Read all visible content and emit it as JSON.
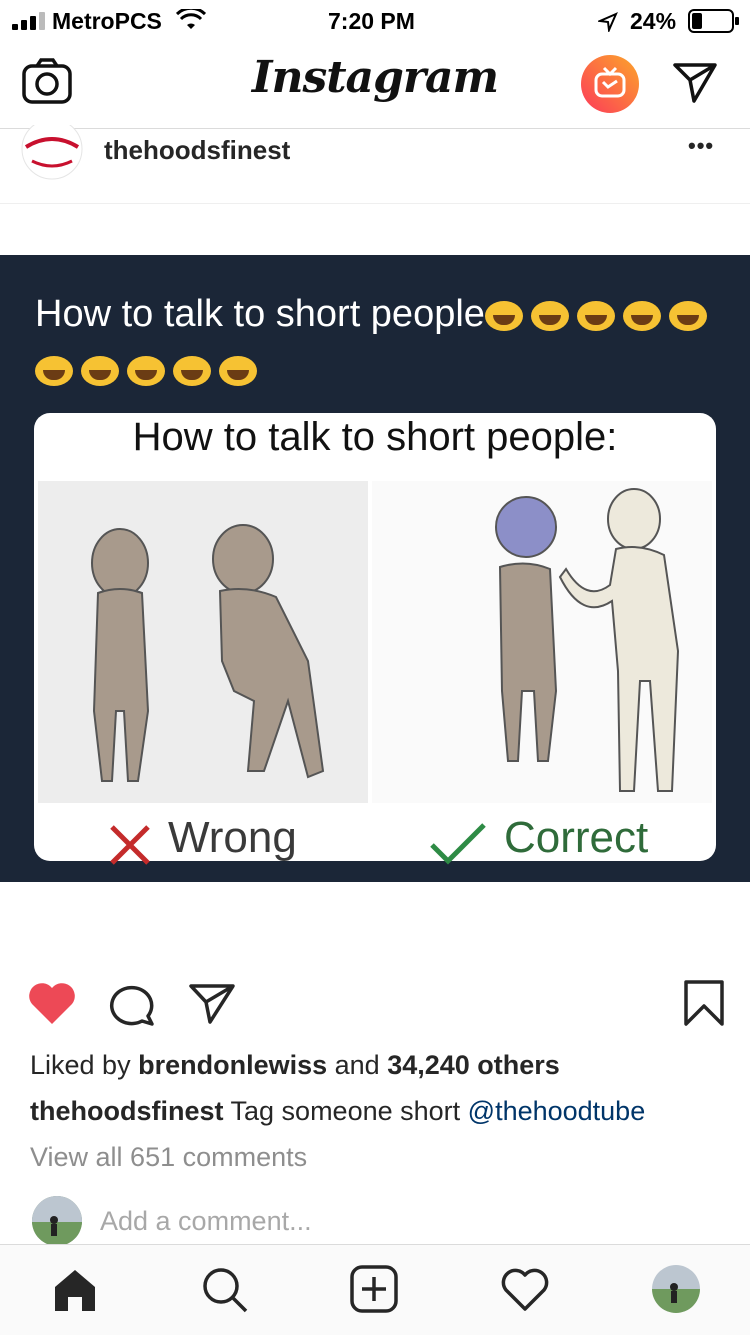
{
  "status": {
    "carrier": "MetroPCS",
    "time": "7:20 PM",
    "battery": "24%"
  },
  "header": {
    "title": "Instagram"
  },
  "post": {
    "username": "thehoodsfinest",
    "more": "•••",
    "image": {
      "caption_top": "How to talk to short people",
      "card_title": "How to talk to short people:",
      "wrong_label": "Wrong",
      "correct_label": "Correct"
    },
    "likes": {
      "prefix": "Liked by ",
      "user": "brendonlewiss",
      "mid": " and ",
      "count": "34,240 others"
    },
    "caption": {
      "user": "thehoodsfinest",
      "text": " Tag someone short ",
      "mention": "@thehoodtube"
    },
    "view_comments": "View all 651 comments",
    "comment_placeholder": "Add a comment..."
  },
  "colors": {
    "like": "#ed4956",
    "igtv_start": "#fd5949",
    "igtv_end": "#f5a623",
    "link": "#003569"
  }
}
